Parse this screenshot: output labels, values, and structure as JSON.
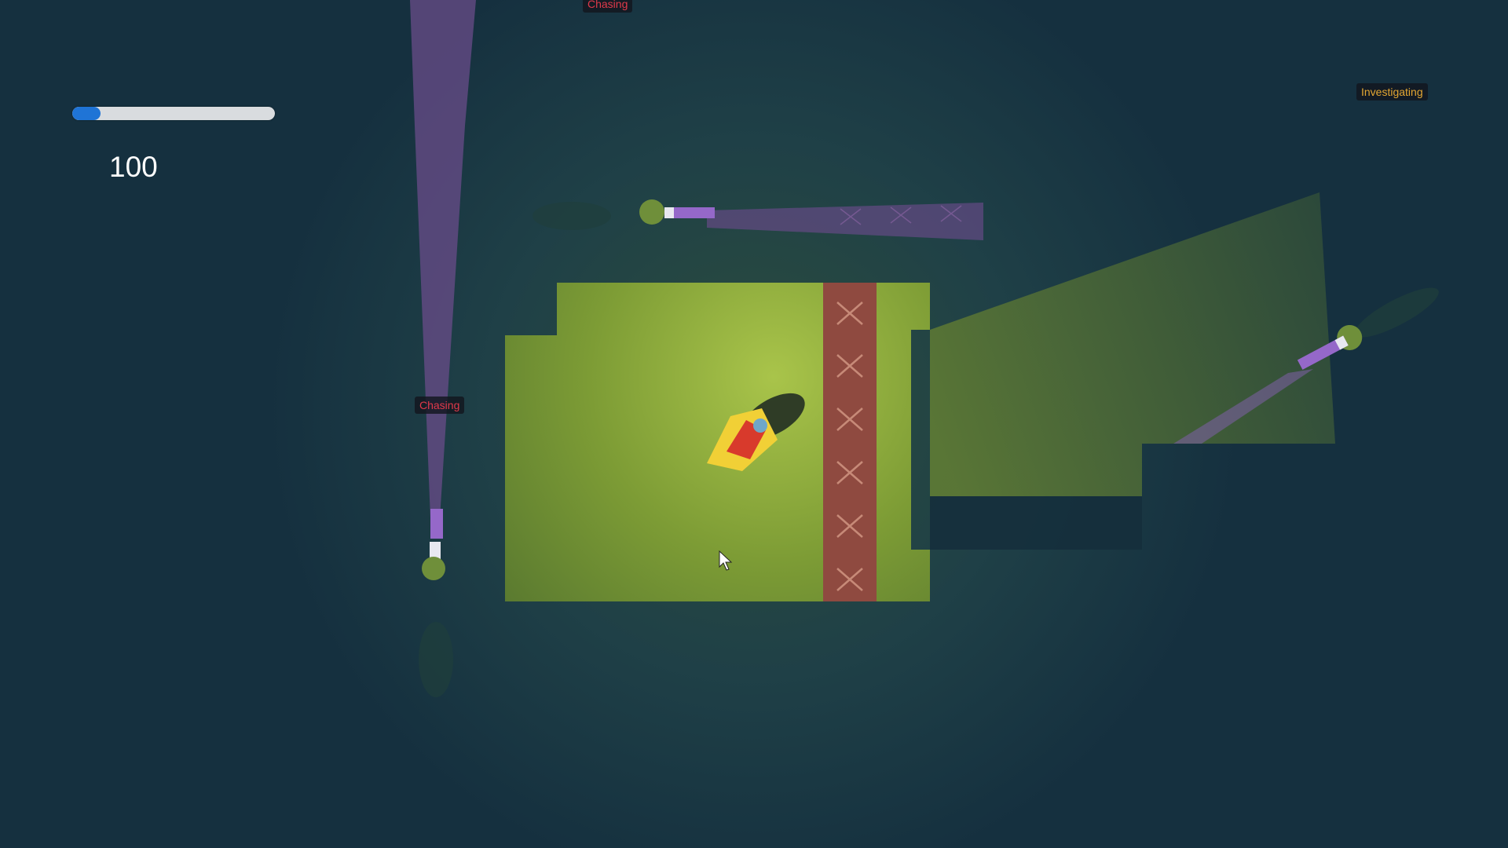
{
  "hud": {
    "health_fraction": 0.14,
    "bar_fill_color": "#1f74d6",
    "bar_track_color": "#d9dcdf",
    "score": "100"
  },
  "enemies": {
    "left_status": "Chasing",
    "top_status": "Chasing",
    "right_status": "Investigating"
  },
  "colors": {
    "floor": "#7a9a33",
    "hazard_strip": "#8f4a40",
    "chasing_text": "#e0394a",
    "investigating_text": "#e3a632",
    "vision_cone": "#6a4c8a",
    "background": "#15303f"
  },
  "icons": [
    "player-character-icon",
    "guard-icon",
    "mouse-cursor-icon",
    "x-mark-icon"
  ]
}
